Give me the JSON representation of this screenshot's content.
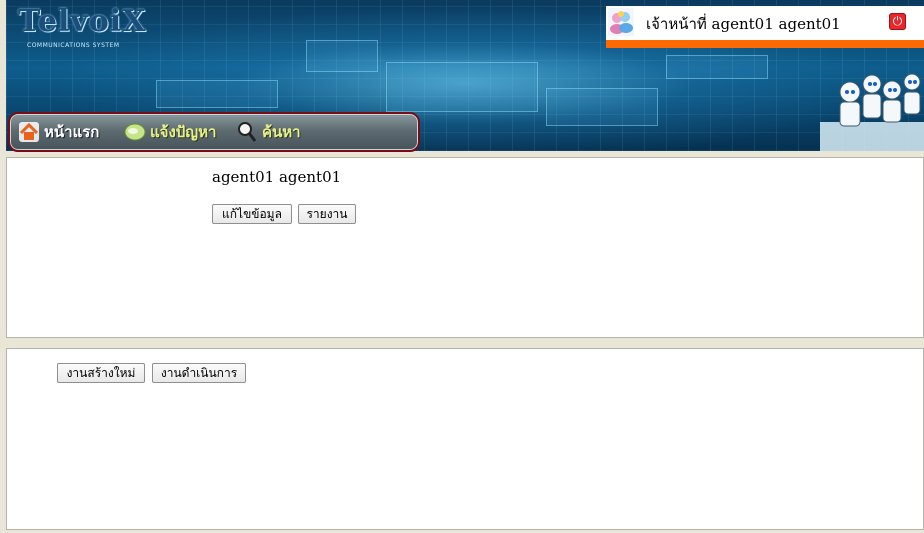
{
  "header": {
    "logo_text": "TelvoiX",
    "logo_subtitle": "COMMUNICATIONS SYSTEM",
    "user_label": "เจ้าหน้าที่ agent01 agent01",
    "power_icon": "power-icon"
  },
  "menu": {
    "items": [
      {
        "label": "หน้าแรก",
        "icon": "home-icon"
      },
      {
        "label": "แจ้งปัญหา",
        "icon": "chat-icon"
      },
      {
        "label": "ค้นหา",
        "icon": "magnifier-icon"
      }
    ]
  },
  "profile_panel": {
    "name": "agent01 agent01",
    "edit_button": "แก้ไขข้อมูล",
    "report_button": "รายงาน"
  },
  "jobs_panel": {
    "new_job_button": "งานสร้างใหม่",
    "in_progress_button": "งานดำเนินการ"
  },
  "colors": {
    "accent_orange": "#ff6a00",
    "power_red": "#e8262c",
    "menu_border": "#7a0c16",
    "banner_blue": "#0e5d8c"
  }
}
